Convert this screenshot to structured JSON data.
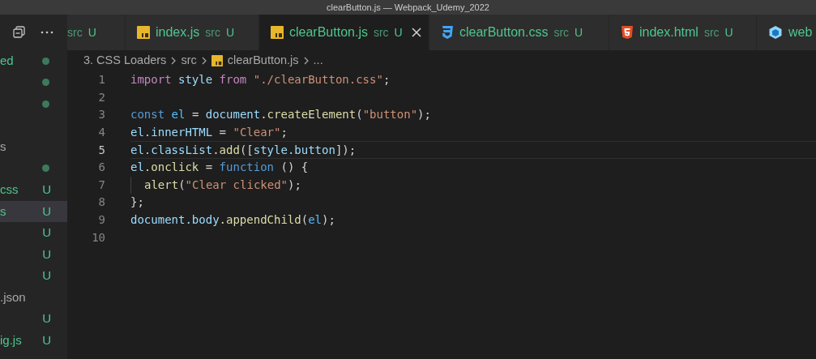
{
  "window": {
    "title": "clearButton.js — Webpack_Udemy_2022"
  },
  "sidebar": {
    "items": [
      {
        "label": "ed",
        "untracked": true,
        "selected": false,
        "kind": "dot"
      },
      {
        "selected": false,
        "kind": "dot"
      },
      {
        "selected": false,
        "kind": "dot"
      },
      {
        "selected": false
      },
      {
        "label": "s",
        "untracked": false,
        "selected": false
      },
      {
        "selected": false,
        "kind": "dot"
      },
      {
        "label": "css",
        "untracked": true,
        "selected": false,
        "kind": "letter",
        "badge": "U"
      },
      {
        "label": "s",
        "untracked": true,
        "selected": true,
        "kind": "letter",
        "badge": "U"
      },
      {
        "selected": false,
        "kind": "letter",
        "badge": "U"
      },
      {
        "selected": false,
        "kind": "letter",
        "badge": "U"
      },
      {
        "selected": false,
        "kind": "letter",
        "badge": "U"
      },
      {
        "label": ".json",
        "untracked": false,
        "selected": false
      },
      {
        "selected": false,
        "kind": "letter",
        "badge": "U"
      },
      {
        "label": "ig.js",
        "untracked": true,
        "selected": false,
        "kind": "letter",
        "badge": "U"
      }
    ]
  },
  "tabs": [
    {
      "description": "src",
      "badge": "U",
      "selected": false
    },
    {
      "kind": "js",
      "label": "index.js",
      "description": "src",
      "badge": "U",
      "selected": false
    },
    {
      "kind": "js",
      "label": "clearButton.js",
      "description": "src",
      "badge": "U",
      "selected": true
    },
    {
      "kind": "css",
      "label": "clearButton.css",
      "description": "src",
      "badge": "U",
      "selected": false
    },
    {
      "kind": "html",
      "label": "index.html",
      "description": "src",
      "badge": "U",
      "selected": false
    },
    {
      "kind": "webpack",
      "label": "web",
      "selected": false
    }
  ],
  "breadcrumb": [
    "3. CSS Loaders",
    "src",
    "clearButton.js",
    "..."
  ],
  "editor": {
    "lines": [
      {
        "number": "1",
        "current": false,
        "tokens": [
          {
            "kind": "keyword",
            "text": "import"
          },
          {
            "kind": "variable",
            "text": " style"
          },
          {
            "kind": "keyword",
            "text": " from"
          },
          {
            "kind": "string",
            "text": " \"./clearButton.css\""
          },
          {
            "kind": "plain",
            "text": ";"
          }
        ]
      },
      {
        "number": "2",
        "current": false
      },
      {
        "number": "3",
        "current": false,
        "tokens": [
          {
            "kind": "storage",
            "text": "const"
          },
          {
            "kind": "constant",
            "text": " el"
          },
          {
            "kind": "plain",
            "text": " = "
          },
          {
            "kind": "variable",
            "text": "document"
          },
          {
            "kind": "function",
            "text": ".createElement"
          },
          {
            "kind": "plain",
            "text": "("
          },
          {
            "kind": "string",
            "text": "\"button\""
          },
          {
            "kind": "plain",
            "text": ");"
          }
        ]
      },
      {
        "number": "4",
        "current": false,
        "tokens": [
          {
            "kind": "variable",
            "text": "el.innerHTML"
          },
          {
            "kind": "plain",
            "text": " = "
          },
          {
            "kind": "string",
            "text": "\"Clear\""
          },
          {
            "kind": "plain",
            "text": ";"
          }
        ]
      },
      {
        "number": "5",
        "current": true,
        "tokens": [
          {
            "kind": "variable",
            "text": "el.classList"
          },
          {
            "kind": "function",
            "text": ".add"
          },
          {
            "kind": "plain",
            "text": "(["
          },
          {
            "kind": "variable",
            "text": "style.button"
          },
          {
            "kind": "plain",
            "text": "]);"
          }
        ]
      },
      {
        "number": "6",
        "current": false,
        "tokens": [
          {
            "kind": "variable",
            "text": "el"
          },
          {
            "kind": "function",
            "text": ".onclick"
          },
          {
            "kind": "plain",
            "text": " = "
          },
          {
            "kind": "storage",
            "text": "function"
          },
          {
            "kind": "plain",
            "text": " () {"
          }
        ]
      },
      {
        "number": "7",
        "current": false,
        "indent": true,
        "tokens": [
          {
            "kind": "function",
            "text": "alert"
          },
          {
            "kind": "plain",
            "text": "("
          },
          {
            "kind": "string",
            "text": "\"Clear clicked\""
          },
          {
            "kind": "plain",
            "text": ");"
          }
        ]
      },
      {
        "number": "8",
        "current": false,
        "tokens": [
          {
            "kind": "plain",
            "text": "};"
          }
        ]
      },
      {
        "number": "9",
        "current": false,
        "tokens": [
          {
            "kind": "variable",
            "text": "document.body"
          },
          {
            "kind": "function",
            "text": ".appendChild"
          },
          {
            "kind": "plain",
            "text": "("
          },
          {
            "kind": "constant",
            "text": "el"
          },
          {
            "kind": "plain",
            "text": ");"
          }
        ]
      },
      {
        "number": "10",
        "current": false
      }
    ]
  }
}
